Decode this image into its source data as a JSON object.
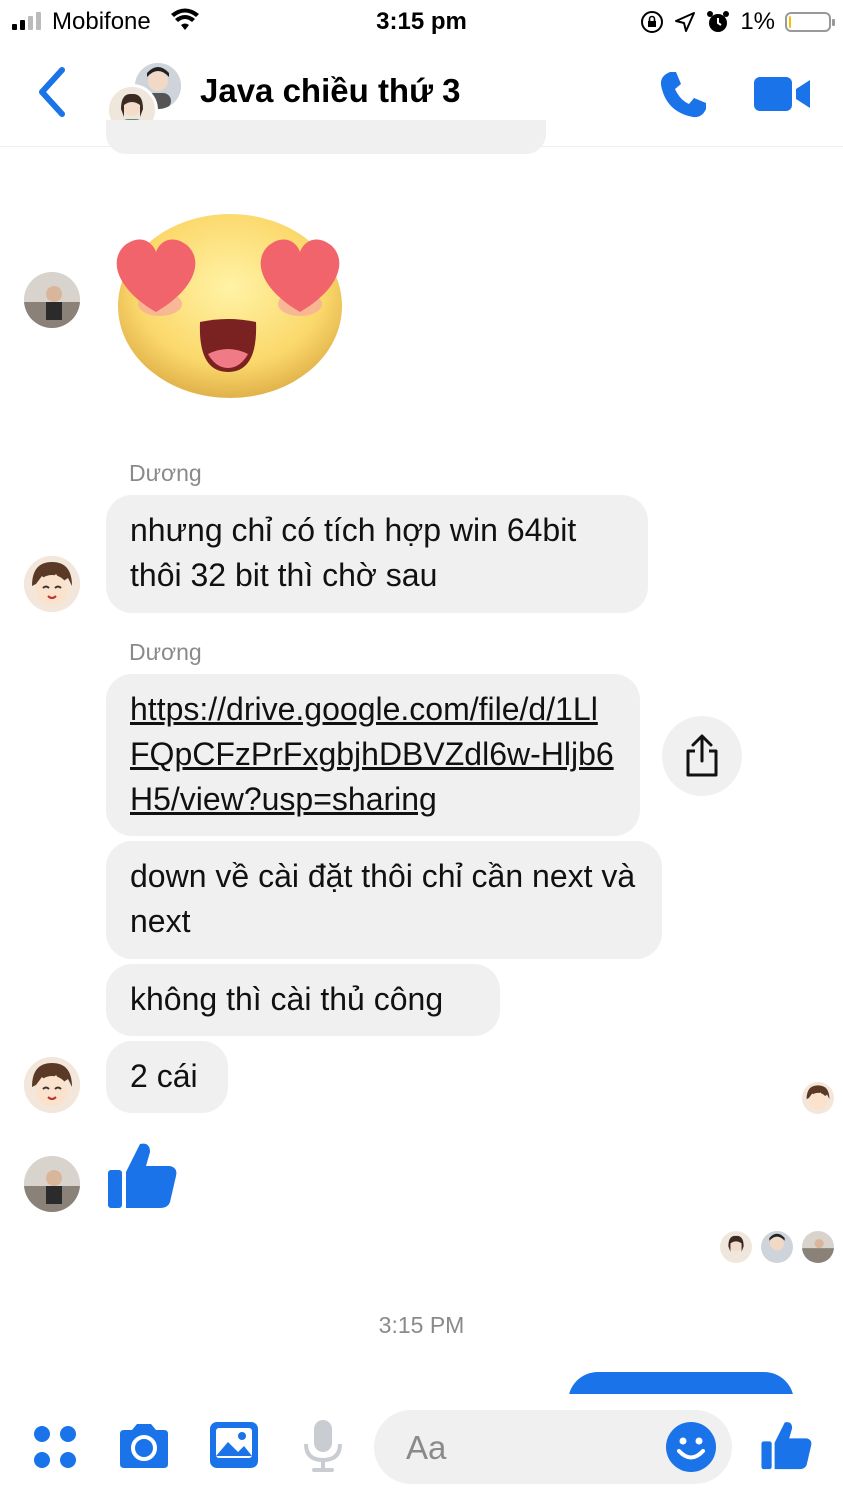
{
  "status_bar": {
    "carrier": "Mobifone",
    "time": "3:15 pm",
    "battery_text": "1%",
    "battery_level": 0.01
  },
  "header": {
    "title": "Java chiều thứ 3"
  },
  "messages": [
    {
      "sender": "Dương",
      "text": "nhưng chỉ có tích hợp win 64bit thôi 32 bit thì chờ sau"
    },
    {
      "sender": "Dương",
      "link_text": "https://drive.google.com/file/d/1LlFQpCFzPrFxgbjhDBVZdl6w-Hljb6H5/view?usp=sharing"
    },
    {
      "text": "down về cài đặt thôi chỉ cần next và next"
    },
    {
      "text": "không thì cài thủ công"
    },
    {
      "text": "2 cái"
    }
  ],
  "timestamp": "3:15 PM",
  "composer": {
    "placeholder": "Aa"
  },
  "colors": {
    "accent": "#1a73e8",
    "bubble_gray": "#f0f0f0",
    "meta_text": "#8a8a8a"
  },
  "icons": {
    "back": "chevron-left-icon",
    "call": "phone-icon",
    "video": "video-camera-icon",
    "share": "share-icon",
    "like": "thumbs-up-icon",
    "apps": "four-dots-icon",
    "camera": "camera-icon",
    "gallery": "image-icon",
    "mic": "microphone-icon",
    "emoji": "smiley-icon",
    "sticker": "heart-eyes-emoji-icon"
  }
}
